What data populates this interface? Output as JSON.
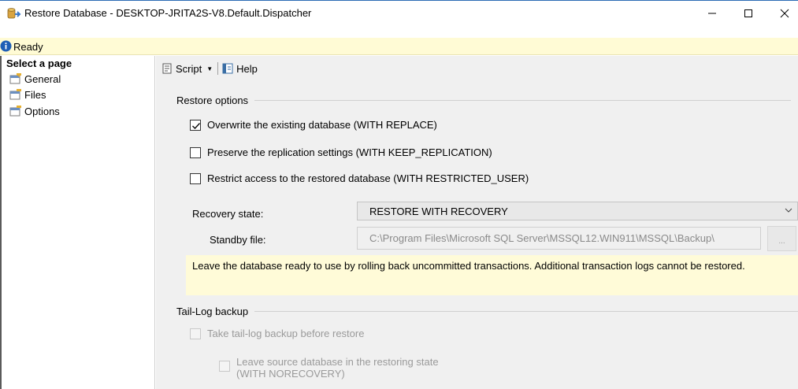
{
  "window": {
    "title": "Restore Database - DESKTOP-JRITA2S-V8.Default.Dispatcher",
    "minimize_glyph": "—",
    "maximize_glyph": "☐",
    "close_glyph": "✕"
  },
  "status": {
    "text": "Ready",
    "icon": "info-icon",
    "accent": "#1f5fb5"
  },
  "sidebar": {
    "heading": "Select a page",
    "items": [
      {
        "label": "General"
      },
      {
        "label": "Files"
      },
      {
        "label": "Options"
      }
    ]
  },
  "toolbar": {
    "script_label": "Script",
    "help_label": "Help"
  },
  "restore_options": {
    "header": "Restore options",
    "overwrite": {
      "label": "Overwrite the existing database (WITH REPLACE)",
      "checked": true
    },
    "preserve": {
      "label": "Preserve the replication settings (WITH KEEP_REPLICATION)",
      "checked": false
    },
    "restrict": {
      "label": "Restrict access to the restored database (WITH RESTRICTED_USER)",
      "checked": false
    },
    "recovery_label": "Recovery state:",
    "recovery_value": "RESTORE WITH RECOVERY",
    "standby_label": "Standby file:",
    "standby_value": "C:\\Program Files\\Microsoft SQL Server\\MSSQL12.WIN911\\MSSQL\\Backup\\",
    "browse_label": "...",
    "description": "Leave the database ready to use by rolling back uncommitted transactions. Additional transaction logs cannot be restored."
  },
  "tail_log": {
    "header": "Tail-Log backup",
    "take_backup": {
      "label": "Take tail-log backup before restore",
      "checked": false,
      "enabled": false
    },
    "leave_source_line1": "Leave source database in the restoring state",
    "leave_source_line2": "(WITH NORECOVERY)"
  }
}
